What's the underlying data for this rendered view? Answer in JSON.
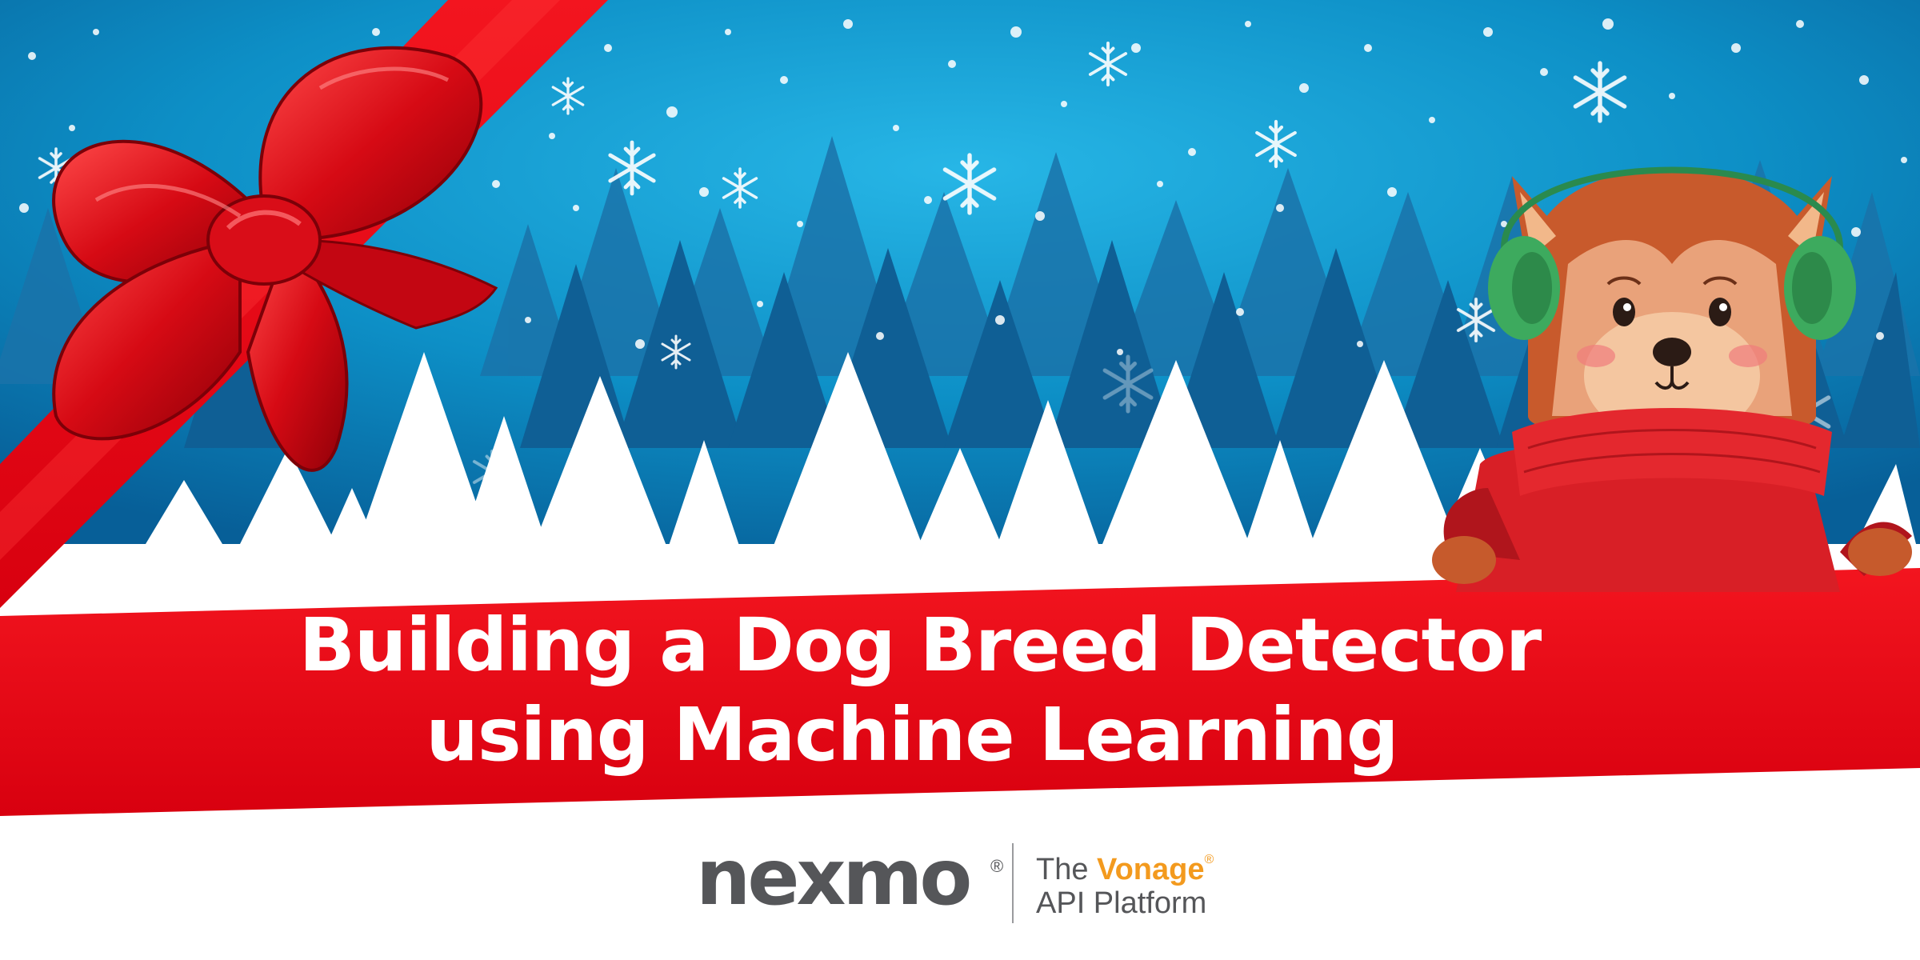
{
  "title": {
    "line1": "Building a Dog Breed Detector",
    "line2": "using Machine Learning"
  },
  "logo": {
    "name": "nexmo",
    "registered": "®",
    "tagline_prefix": "The",
    "tagline_brand": "Vonage",
    "tagline_brand_registered": "®",
    "tagline_suffix": "API Platform"
  },
  "colors": {
    "sky": "#0f8fc4",
    "ribbon": "#e8111e",
    "snow": "#ffffff",
    "logo_gray": "#555659",
    "vonage_orange": "#f39a1e"
  },
  "icons": [
    "bow-icon",
    "dog-illustration-icon",
    "snowflake-icon",
    "tree-icon",
    "nexmo-logo-icon"
  ]
}
